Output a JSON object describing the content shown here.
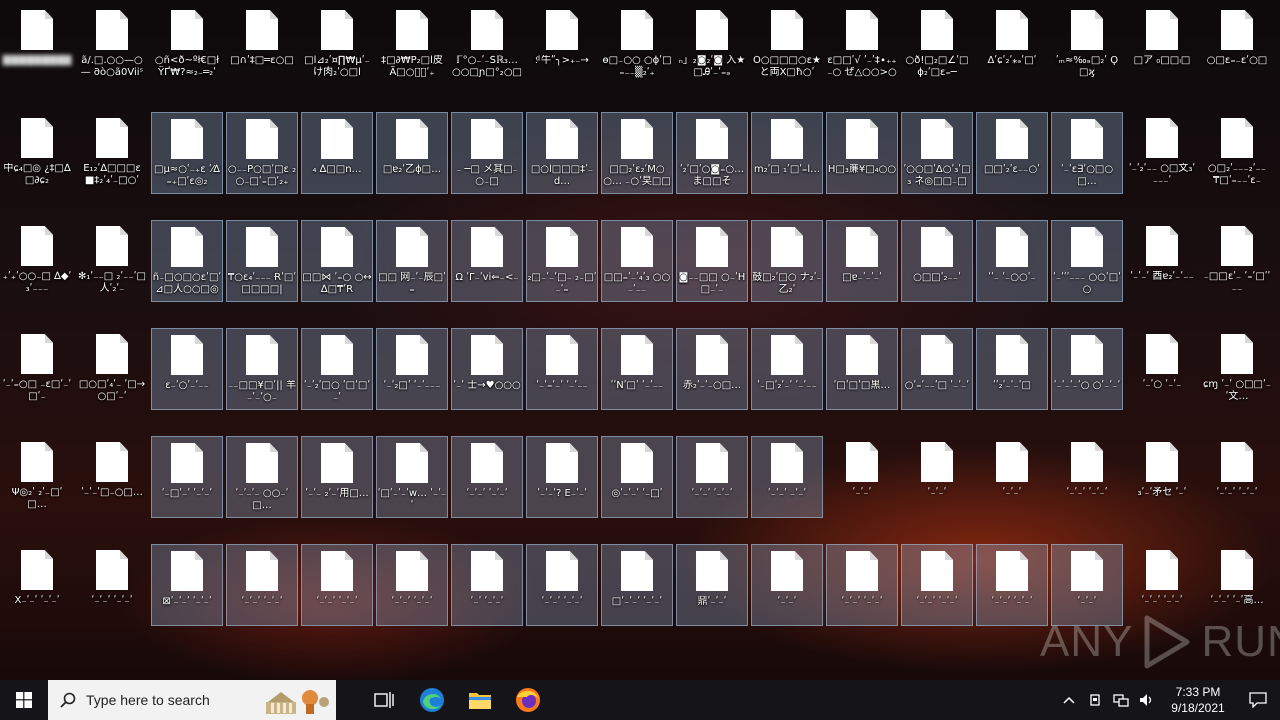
{
  "desktop": {
    "rows": [
      {
        "selected_cols": [],
        "labels": [
          "▓▓▓▓▓▓▓▓▓",
          "ã/.□.○○—○— 𐐀ò○ã0Viiˢ ₔ…",
          "○ñ<ð~ºł€□ł ΫҐ₩?≈₂₋═₂ʹ",
          "□∩ʹ‡□═ɛ○□",
          "□l⊿₂ʹ¤∏₩µʹ₋ け肉₂ʹ○□l",
          "‡□∂₩Ρ₂□l皮 Ã□○ち᷊ʹ₊",
          "ℾ°○₋ʹ₋Ṧℝ₃… ○○□ɲ□°₂○□",
          ":ͩ 牛ʺ╮>₊₋→",
          "ɵ□₋○○ ○ɸ̈ʹ□₌₋₋▒₂ʹ₊",
          "ₙ」₂◙₂ʹ◙ 入★□Ꭿʹ₋ʹ₌ₔ",
          "Õ○□□□○ɛ★ と両X□ħ○ʹ",
          "ɛ□□ʹ√ ʹ₋ʹ‡∙₊₊₋○ ぜ△○○>○<<",
          "○ð!□₂□∠ʹ□ ɸ₂ʹ□ɛ₌─",
          "Δʹɕʹ₂ʹ⁎ₔʹ□ʹ",
          "ʹₘ≈‰ₔ□₂ʹ Ϙ□ϗ",
          "□ア ₀□□ₗ□",
          "○□ɛ₌₋ɛʹ○□"
        ]
      },
      {
        "selected_cols": [
          2,
          3,
          4,
          5,
          6,
          7,
          8,
          9,
          10,
          11,
          12,
          13,
          14
        ],
        "labels": [
          "中ɕ₄□◎ ¿‡□∆□∂ɕ₂",
          "Ē₁₂ʹ∆□□□ɛ ■‡₂ʹ₄ʹ₋□○ʹ",
          "□µ≈○ʹ₋₊ɛ ʹ⁄∆₌₊□ʹɛ◎₂",
          "○₋₋P○□ʹ□ɛ ₂○₋□ʹ₌□ʹ₂₊",
          "₄ ∆□□n…",
          "□ɐ₂ʹ乙ɸ□…",
          "₋ ─□ メ其□₋○₋□",
          "□○l□□□‡ʹ₋d…",
          "□□₂ʹɛ₂ʹM○○… ₋○ʹ旲□□□₂ʹ",
          "ʹ₂ʹ□ʹ○◙₌○… ま□□そ",
          "m₂ʹ□ ₁ʹ□ʹ₌l…",
          "H□₃亷¥□₄○○",
          "ʹ○○□ʹΔ○ʹ₃ʹ□₃ ネ◎□□₋□",
          "□□ʹ₂ʹɛ₋₋○ʹ",
          "ʹ₋ʹɛ∃ʹ○□○□…",
          "ʹ₋ʹ₂ʹ₋₋ ○□文₃ʹ₋₋₋ʹ",
          "○□₂ʹ₋₋₋₂ʹ₋₋ ₸□ʹ₌₋₋ʹɛ₋"
        ]
      },
      {
        "selected_cols": [
          2,
          3,
          4,
          5,
          6,
          7,
          8,
          9,
          10,
          11,
          12,
          13,
          14
        ],
        "labels": [
          "₊ʹ₊ʹ○○₋□ ∆◆ʹ₃ʹ₋₋₋",
          "✻₁ʹ₋₋□ ₂ʹ₋₋ʹ□人ʹ₂ʹ₋",
          "ñ₋□○□○ɛʹ□ʹ ⊿□人○○□◎",
          "₸○ɛ₄ʹ₋₋₋ Ɍʹ□ʹ□□□□|",
          "□□⋈ ʹ₌○ ○↔∆□₸ʹR",
          "□□ 网₋ʹ₋辰□ʹ₌",
          "Ω ʹΓ₋ʹvi⇐₋<₋",
          "₂□₋ʹ₋ʹ□₋ ₂₋□ʹ₋ʹ₌",
          "□□₌ʹ₋ʹ₄ʹ₃ ○○₋ʹ₋₋",
          "◙₋₋□□ ○₋ʹH□₋ʹ₋",
          "鼓□₂ʹ□○ ナ₂ʹ₋乙₂ʹ",
          "□ɐ₋ʹ₋ʹ₋ʹ",
          "○□□ʹ₂₋₋ʹ",
          "ʹʹ₋ ʹ₋○○ʹ₋",
          "ʹ₋ʹʹʹ₋₋₋ ○○ʹ□ʹ○",
          "ʹ₋ʹ₋ʹ 酉ɐ₂ʹ₋ʹ₋₋",
          "₋□□ɛʹ₋ ʹ₌ʹ□ʹʹ₋₋"
        ]
      },
      {
        "selected_cols": [
          2,
          3,
          4,
          5,
          6,
          7,
          8,
          9,
          10,
          11,
          12,
          13,
          14
        ],
        "labels": [
          "ʹ₋ʹ₌○□ ₋ɛ□ʹ₋ʹ□ʹ₋",
          "□○□ʹ₄ʹ₋ ʹ□→○□ʹ₋ʹ",
          "ɛ₋ʹ○ʹ₋ʹ₋₋",
          "₋₋□□¥□ʹ|| 羊₋ʹ₋ʹ○₋",
          "ʹ₋ʹ₂ʹ□○ ʹ□ʹ□ʹ₋ʹ",
          "ʹ₋ʹ₂□ʹ ʹ₋ʹ₋₋₋",
          "ʹ₋ʹ 士→♥○○○",
          "ʹ₋ʹ₌ʹ₋ʹ ʹ₋ʹ₋₋",
          "ʹʹNʹ□ʹ ʹ₋ʹ₋₋",
          "赤₂ʹ₋ʹ₋○□…",
          "ʹ₋□ʹ₂ʹ₋ʹ ʹ₋ʹ₋₋",
          "ʹ□ʹ□ʹ□黒…",
          "○ʹ₌ʹ₋₋ʹ□ ʹ₋ʹ₋ʹ",
          "ʹʹ₂ʹ₋ʹ₋ʹ□",
          "ʹ₋ʹ₋ʹ₋ʹ○ ○ʹ₋ʹ₋ʹ",
          "ʹ₋ʹ○ ʹ₋ʹ₋",
          "ɕɱ ʹ₋ʹ ○□□ʹ₋ʹ文…"
        ]
      },
      {
        "selected_cols": [
          2,
          3,
          4,
          5,
          6,
          7,
          8,
          9,
          10
        ],
        "labels": [
          "Ψ◎₂ʹ ₂ʹ₋□ʹ□…",
          "ʹ₋ʹ₋ʹ□₋○□…",
          "ʹ₋□ʹ₋ʹ ʹ₋ʹ₋ʹ",
          "ʹ₋ʹ₋ʹ₋ ○○₋ʹ□…",
          "ʹ₋ʹ₋ ₂ʹ₋ʹ用□…",
          "ʹ□ʹ₋ʹ₋ʹw… ʹ₋ʹ₋ʹ",
          "ʹ₋ʹ₋ʹ ʹ₋ʹ₋ʹ",
          "ʹ₋ʹ₋ʹ? E₋ʹ₋ʹ",
          "◎ʹ₋ʹ₋ʹ ʹ₋□ʹ",
          "ʹ₋ʹ₋ʹ ʹ₋ʹ₋ʹ",
          "ʹ₋ʹ₋ʹ ₋ʹ₋ʹ",
          "ʹ₋ʹ₋ʹ",
          "ʹ₋ʹ₋ʹ",
          "ʹ₋ʹ₋ʹ",
          "ʹ₋ʹ₋ʹ ʹ₋ʹ₋ʹ",
          "₃ʹ₋ʹ矛セ ʹ₋ʹ",
          "ʹ₋ʹ₋ʹ ʹ₋ʹ₋ʹ"
        ]
      },
      {
        "selected_cols": [
          2,
          3,
          4,
          5,
          6,
          7,
          8,
          9,
          10,
          11,
          12,
          13,
          14
        ],
        "labels": [
          "Ẋ₋ʹ₋ʹ ʹ₋ʹ₋ʹ",
          "ʹ₋ʹ₋ʹ ʹ₋ʹ₋ʹ",
          "⊠ʹ₋ʹ₋ʹ ʹ₋ʹ₋ʹ",
          "ʹ₋ʹ₋ʹ ʹ₋ʹ₋ʹ",
          "ʹ₋ʹ₋ʹ ʹ₋ʹ₋ʹ",
          "ʹ₋ʹ₋ʹ ʹ₋ʹ₋ʹ",
          "ʹ₋ʹ ʹ₋ʹ₋ʹ",
          "ʹ₋ʹ₋ʹ ʹ₋ʹ₋ʹ",
          "□ʹ₋ʹ₋ʹ ʹ₋ʹ₋ʹ",
          "鼎ʹ₋ʹ₋ʹ",
          "ʹ₋ʹ₋ʹ",
          "ʹ₋ʹ₋ʹ ʹ₋ʹ₋ʹ",
          "ʹ₋ʹ₋ʹ ʹ₋ʹ₋ʹ",
          "ʹ₋ʹ₋ʹ ʹ₋ʹ₋ʹ",
          "ʹ₋ʹ₋ʹ",
          "ʹ₋ʹ₋ʹ ʹ₋ʹ₋ʹ",
          "ʹ₋ʹ₋ʹ ʹ₋ʹ高…"
        ]
      }
    ]
  },
  "watermark": {
    "text_left": "ANY",
    "text_right": "RUN"
  },
  "taskbar": {
    "search_placeholder": "Type here to search",
    "time": "7:33 PM",
    "date": "9/18/2021",
    "tray_icons": [
      "chevron-up-icon",
      "usb-icon",
      "network-icon",
      "volume-icon"
    ]
  },
  "colors": {
    "taskbar": "#141419",
    "selection": "#8caac8",
    "edge_blue": "#1e7fd6",
    "folder_yellow": "#f3c340",
    "firefox_orange": "#ff7a1a"
  }
}
